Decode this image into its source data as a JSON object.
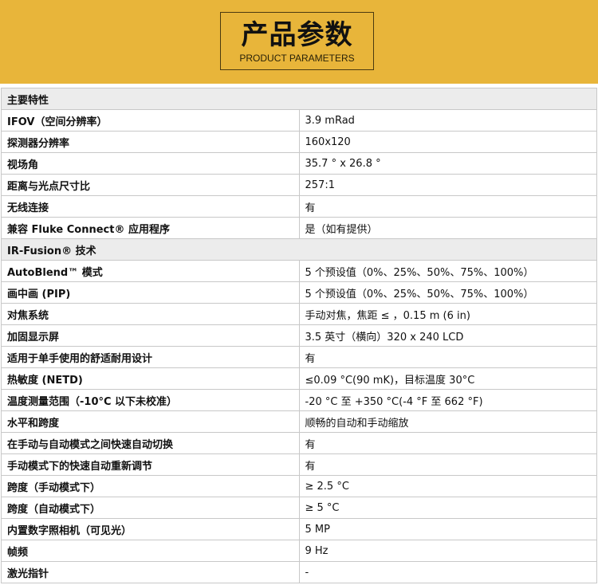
{
  "header": {
    "title_cn": "产品参数",
    "title_en": "PRODUCT PARAMETERS"
  },
  "colors": {
    "banner": "#e8b53a",
    "section_bg": "#ececec",
    "border": "#c8c8c8"
  },
  "table": {
    "section1": "主要特性",
    "rows1": [
      {
        "label": "IFOV（空间分辨率）",
        "value": "3.9 mRad"
      },
      {
        "label": "探测器分辨率",
        "value": "160x120"
      },
      {
        "label": "视场角",
        "value": "35.7 ° x 26.8 °"
      },
      {
        "label": "距离与光点尺寸比",
        "value": "257:1"
      },
      {
        "label": "无线连接",
        "value": "有"
      },
      {
        "label": "兼容 Fluke Connect® 应用程序",
        "value": "是（如有提供）"
      }
    ],
    "section2": "IR-Fusion® 技术",
    "rows2": [
      {
        "label": "AutoBlend™ 模式",
        "value": "5 个预设值（0%、25%、50%、75%、100%）"
      },
      {
        "label": "画中画 (PIP)",
        "value": "5 个预设值（0%、25%、50%、75%、100%）"
      },
      {
        "label": "对焦系统",
        "value": "手动对焦，焦距 ≤ ，0.15 m (6 in)"
      },
      {
        "label": "加固显示屏",
        "value": "3.5 英寸（横向）320 x 240 LCD"
      },
      {
        "label": "适用于单手使用的舒适耐用设计",
        "value": "有"
      },
      {
        "label": "热敏度 (NETD)",
        "value": "≤0.09 °C(90 mK)，目标温度 30°C"
      },
      {
        "label": "温度测量范围（-10°C 以下未校准）",
        "value": "-20 °C 至 +350 °C(-4 °F 至 662 °F)"
      },
      {
        "label": "水平和跨度",
        "value": "顺畅的自动和手动缩放"
      },
      {
        "label": "在手动与自动模式之间快速自动切换",
        "value": "有"
      },
      {
        "label": "手动模式下的快速自动重新调节",
        "value": "有"
      },
      {
        "label": "跨度（手动模式下）",
        "value": "≥ 2.5 °C"
      },
      {
        "label": "跨度（自动模式下）",
        "value": "≥ 5 °C"
      },
      {
        "label": "内置数字照相机（可见光）",
        "value": "5 MP"
      },
      {
        "label": "帧频",
        "value": "9 Hz"
      },
      {
        "label": "激光指针",
        "value": "-"
      }
    ]
  }
}
